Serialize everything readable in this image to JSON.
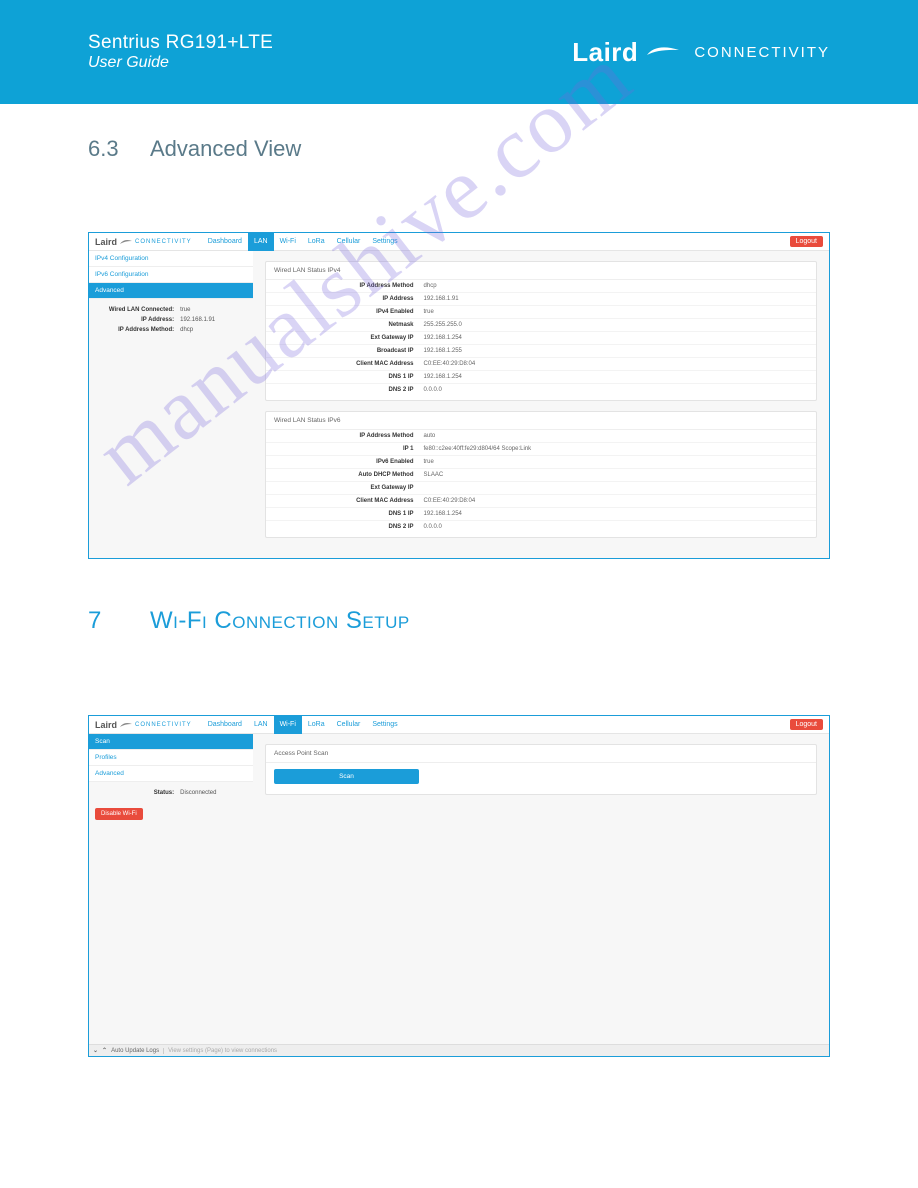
{
  "doc_header": {
    "product": "Sentrius RG191+LTE",
    "subtitle": "User Guide",
    "brand": "Laird",
    "connectivity": "CONNECTIVITY"
  },
  "section1": {
    "num": "6.3",
    "title": "Advanced View"
  },
  "section2": {
    "num": "7",
    "title": "Wi-Fi Connection Setup"
  },
  "watermark_text": "manualshive.com",
  "app1": {
    "brand": "Laird",
    "brand_conn": "CONNECTIVITY",
    "nav": {
      "dashboard": "Dashboard",
      "lan": "LAN",
      "wifi": "Wi-Fi",
      "lora": "LoRa",
      "cellular": "Cellular",
      "settings": "Settings"
    },
    "logout": "Logout",
    "sidebar": {
      "ipv4config": "IPv4 Configuration",
      "ipv6config": "IPv6 Configuration",
      "advanced": "Advanced",
      "summary": [
        {
          "label": "Wired LAN Connected:",
          "value": "true"
        },
        {
          "label": "IP Address:",
          "value": "192.168.1.91"
        },
        {
          "label": "IP Address Method:",
          "value": "dhcp"
        }
      ]
    },
    "panel_ipv4": {
      "title": "Wired LAN Status IPv4",
      "rows": [
        {
          "label": "IP Address Method",
          "value": "dhcp"
        },
        {
          "label": "IP Address",
          "value": "192.168.1.91"
        },
        {
          "label": "IPv4 Enabled",
          "value": "true"
        },
        {
          "label": "Netmask",
          "value": "255.255.255.0"
        },
        {
          "label": "Ext Gateway IP",
          "value": "192.168.1.254"
        },
        {
          "label": "Broadcast IP",
          "value": "192.168.1.255"
        },
        {
          "label": "Client MAC Address",
          "value": "C0:EE:40:29:D8:04"
        },
        {
          "label": "DNS 1 IP",
          "value": "192.168.1.254"
        },
        {
          "label": "DNS 2 IP",
          "value": "0.0.0.0"
        }
      ]
    },
    "panel_ipv6": {
      "title": "Wired LAN Status IPv6",
      "rows": [
        {
          "label": "IP Address Method",
          "value": "auto"
        },
        {
          "label": "IP 1",
          "value": "fe80::c2ee:40ff:fe29:d804/64 Scope:Link"
        },
        {
          "label": "IPv6 Enabled",
          "value": "true"
        },
        {
          "label": "Auto DHCP Method",
          "value": "SLAAC"
        },
        {
          "label": "Ext Gateway IP",
          "value": ""
        },
        {
          "label": "Client MAC Address",
          "value": "C0:EE:40:29:D8:04"
        },
        {
          "label": "DNS 1 IP",
          "value": "192.168.1.254"
        },
        {
          "label": "DNS 2 IP",
          "value": "0.0.0.0"
        }
      ]
    }
  },
  "app2": {
    "brand": "Laird",
    "brand_conn": "CONNECTIVITY",
    "nav": {
      "dashboard": "Dashboard",
      "lan": "LAN",
      "wifi": "Wi-Fi",
      "lora": "LoRa",
      "cellular": "Cellular",
      "settings": "Settings"
    },
    "logout": "Logout",
    "sidebar": {
      "scan": "Scan",
      "profiles": "Profiles",
      "advanced": "Advanced",
      "status_row": {
        "label": "Status:",
        "value": "Disconnected"
      },
      "disable_btn": "Disable Wi-Fi"
    },
    "panel_scan": {
      "title": "Access Point Scan",
      "scan_btn": "Scan"
    },
    "status_bar": {
      "auto_update": "Auto Update Logs",
      "hint": "View settings (Page) to view connections"
    }
  }
}
